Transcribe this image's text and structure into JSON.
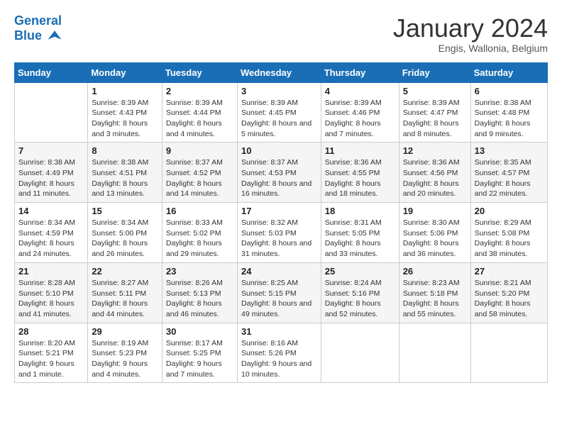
{
  "header": {
    "logo_general": "General",
    "logo_blue": "Blue",
    "month_title": "January 2024",
    "subtitle": "Engis, Wallonia, Belgium"
  },
  "days_of_week": [
    "Sunday",
    "Monday",
    "Tuesday",
    "Wednesday",
    "Thursday",
    "Friday",
    "Saturday"
  ],
  "weeks": [
    [
      {
        "day": "",
        "sunrise": "",
        "sunset": "",
        "daylight": ""
      },
      {
        "day": "1",
        "sunrise": "Sunrise: 8:39 AM",
        "sunset": "Sunset: 4:43 PM",
        "daylight": "Daylight: 8 hours and 3 minutes."
      },
      {
        "day": "2",
        "sunrise": "Sunrise: 8:39 AM",
        "sunset": "Sunset: 4:44 PM",
        "daylight": "Daylight: 8 hours and 4 minutes."
      },
      {
        "day": "3",
        "sunrise": "Sunrise: 8:39 AM",
        "sunset": "Sunset: 4:45 PM",
        "daylight": "Daylight: 8 hours and 5 minutes."
      },
      {
        "day": "4",
        "sunrise": "Sunrise: 8:39 AM",
        "sunset": "Sunset: 4:46 PM",
        "daylight": "Daylight: 8 hours and 7 minutes."
      },
      {
        "day": "5",
        "sunrise": "Sunrise: 8:39 AM",
        "sunset": "Sunset: 4:47 PM",
        "daylight": "Daylight: 8 hours and 8 minutes."
      },
      {
        "day": "6",
        "sunrise": "Sunrise: 8:38 AM",
        "sunset": "Sunset: 4:48 PM",
        "daylight": "Daylight: 8 hours and 9 minutes."
      }
    ],
    [
      {
        "day": "7",
        "sunrise": "Sunrise: 8:38 AM",
        "sunset": "Sunset: 4:49 PM",
        "daylight": "Daylight: 8 hours and 11 minutes."
      },
      {
        "day": "8",
        "sunrise": "Sunrise: 8:38 AM",
        "sunset": "Sunset: 4:51 PM",
        "daylight": "Daylight: 8 hours and 13 minutes."
      },
      {
        "day": "9",
        "sunrise": "Sunrise: 8:37 AM",
        "sunset": "Sunset: 4:52 PM",
        "daylight": "Daylight: 8 hours and 14 minutes."
      },
      {
        "day": "10",
        "sunrise": "Sunrise: 8:37 AM",
        "sunset": "Sunset: 4:53 PM",
        "daylight": "Daylight: 8 hours and 16 minutes."
      },
      {
        "day": "11",
        "sunrise": "Sunrise: 8:36 AM",
        "sunset": "Sunset: 4:55 PM",
        "daylight": "Daylight: 8 hours and 18 minutes."
      },
      {
        "day": "12",
        "sunrise": "Sunrise: 8:36 AM",
        "sunset": "Sunset: 4:56 PM",
        "daylight": "Daylight: 8 hours and 20 minutes."
      },
      {
        "day": "13",
        "sunrise": "Sunrise: 8:35 AM",
        "sunset": "Sunset: 4:57 PM",
        "daylight": "Daylight: 8 hours and 22 minutes."
      }
    ],
    [
      {
        "day": "14",
        "sunrise": "Sunrise: 8:34 AM",
        "sunset": "Sunset: 4:59 PM",
        "daylight": "Daylight: 8 hours and 24 minutes."
      },
      {
        "day": "15",
        "sunrise": "Sunrise: 8:34 AM",
        "sunset": "Sunset: 5:00 PM",
        "daylight": "Daylight: 8 hours and 26 minutes."
      },
      {
        "day": "16",
        "sunrise": "Sunrise: 8:33 AM",
        "sunset": "Sunset: 5:02 PM",
        "daylight": "Daylight: 8 hours and 29 minutes."
      },
      {
        "day": "17",
        "sunrise": "Sunrise: 8:32 AM",
        "sunset": "Sunset: 5:03 PM",
        "daylight": "Daylight: 8 hours and 31 minutes."
      },
      {
        "day": "18",
        "sunrise": "Sunrise: 8:31 AM",
        "sunset": "Sunset: 5:05 PM",
        "daylight": "Daylight: 8 hours and 33 minutes."
      },
      {
        "day": "19",
        "sunrise": "Sunrise: 8:30 AM",
        "sunset": "Sunset: 5:06 PM",
        "daylight": "Daylight: 8 hours and 36 minutes."
      },
      {
        "day": "20",
        "sunrise": "Sunrise: 8:29 AM",
        "sunset": "Sunset: 5:08 PM",
        "daylight": "Daylight: 8 hours and 38 minutes."
      }
    ],
    [
      {
        "day": "21",
        "sunrise": "Sunrise: 8:28 AM",
        "sunset": "Sunset: 5:10 PM",
        "daylight": "Daylight: 8 hours and 41 minutes."
      },
      {
        "day": "22",
        "sunrise": "Sunrise: 8:27 AM",
        "sunset": "Sunset: 5:11 PM",
        "daylight": "Daylight: 8 hours and 44 minutes."
      },
      {
        "day": "23",
        "sunrise": "Sunrise: 8:26 AM",
        "sunset": "Sunset: 5:13 PM",
        "daylight": "Daylight: 8 hours and 46 minutes."
      },
      {
        "day": "24",
        "sunrise": "Sunrise: 8:25 AM",
        "sunset": "Sunset: 5:15 PM",
        "daylight": "Daylight: 8 hours and 49 minutes."
      },
      {
        "day": "25",
        "sunrise": "Sunrise: 8:24 AM",
        "sunset": "Sunset: 5:16 PM",
        "daylight": "Daylight: 8 hours and 52 minutes."
      },
      {
        "day": "26",
        "sunrise": "Sunrise: 8:23 AM",
        "sunset": "Sunset: 5:18 PM",
        "daylight": "Daylight: 8 hours and 55 minutes."
      },
      {
        "day": "27",
        "sunrise": "Sunrise: 8:21 AM",
        "sunset": "Sunset: 5:20 PM",
        "daylight": "Daylight: 8 hours and 58 minutes."
      }
    ],
    [
      {
        "day": "28",
        "sunrise": "Sunrise: 8:20 AM",
        "sunset": "Sunset: 5:21 PM",
        "daylight": "Daylight: 9 hours and 1 minute."
      },
      {
        "day": "29",
        "sunrise": "Sunrise: 8:19 AM",
        "sunset": "Sunset: 5:23 PM",
        "daylight": "Daylight: 9 hours and 4 minutes."
      },
      {
        "day": "30",
        "sunrise": "Sunrise: 8:17 AM",
        "sunset": "Sunset: 5:25 PM",
        "daylight": "Daylight: 9 hours and 7 minutes."
      },
      {
        "day": "31",
        "sunrise": "Sunrise: 8:16 AM",
        "sunset": "Sunset: 5:26 PM",
        "daylight": "Daylight: 9 hours and 10 minutes."
      },
      {
        "day": "",
        "sunrise": "",
        "sunset": "",
        "daylight": ""
      },
      {
        "day": "",
        "sunrise": "",
        "sunset": "",
        "daylight": ""
      },
      {
        "day": "",
        "sunrise": "",
        "sunset": "",
        "daylight": ""
      }
    ]
  ]
}
